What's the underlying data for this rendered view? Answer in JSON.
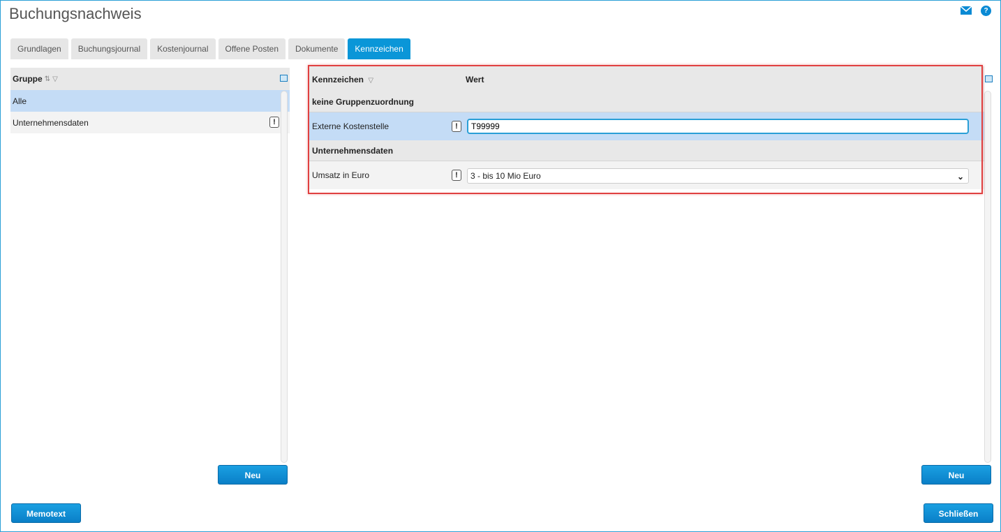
{
  "window": {
    "title": "Buchungsnachweis"
  },
  "header_icons": {
    "mail": "mail-icon",
    "help": "help-icon"
  },
  "tabs": [
    {
      "label": "Grundlagen"
    },
    {
      "label": "Buchungsjournal"
    },
    {
      "label": "Kostenjournal"
    },
    {
      "label": "Offene Posten"
    },
    {
      "label": "Dokumente"
    },
    {
      "label": "Kennzeichen",
      "active": true
    }
  ],
  "left_panel": {
    "column_header": "Gruppe",
    "items": [
      {
        "label": "Alle",
        "selected": true
      },
      {
        "label": "Unternehmensdaten",
        "has_flag": true
      }
    ],
    "new_button": "Neu"
  },
  "right_panel": {
    "columns": {
      "kennzeichen": "Kennzeichen",
      "wert": "Wert"
    },
    "groups": [
      {
        "label": "keine Gruppenzuordnung",
        "rows": [
          {
            "label": "Externe Kostenstelle",
            "value": "T99999",
            "type": "input",
            "selected": true
          }
        ]
      },
      {
        "label": "Unternehmensdaten",
        "rows": [
          {
            "label": "Umsatz in Euro",
            "value": "3 - bis 10 Mio Euro",
            "type": "select"
          }
        ]
      }
    ],
    "new_button": "Neu"
  },
  "footer": {
    "memo_button": "Memotext",
    "close_button": "Schließen"
  },
  "flag_glyph": "!",
  "colors": {
    "accent": "#0a96d8",
    "selection": "#c4dcf6",
    "highlight_border": "#e04040"
  }
}
